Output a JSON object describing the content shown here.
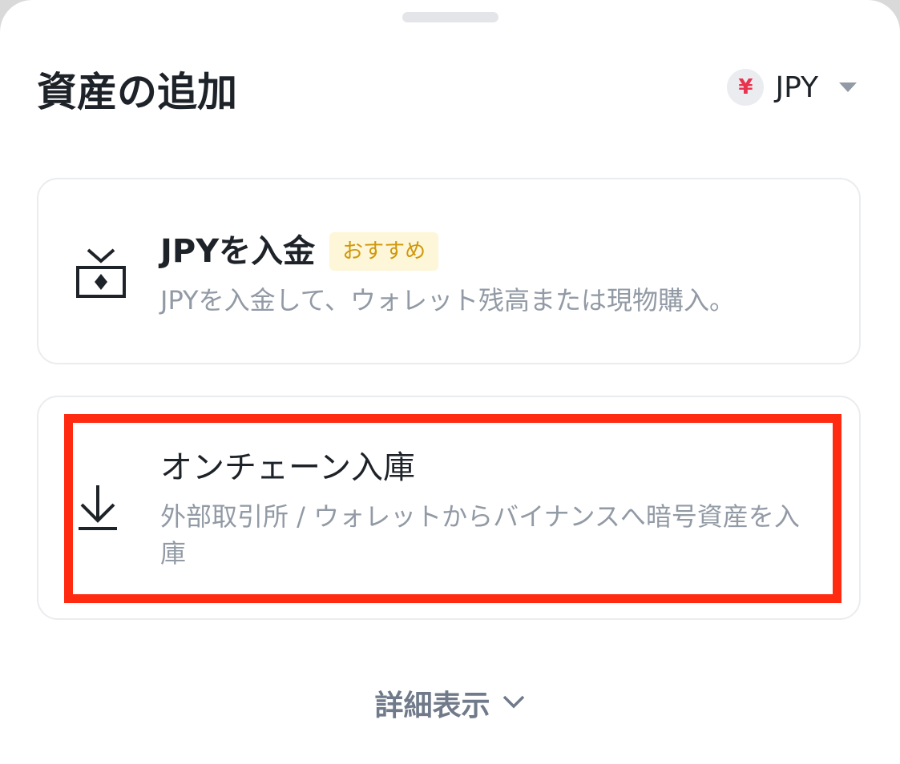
{
  "header": {
    "title": "資産の追加",
    "currency_symbol": "¥",
    "currency_code": "JPY"
  },
  "options": [
    {
      "title": "JPYを入金",
      "badge": "おすすめ",
      "description": "JPYを入金して、ウォレット残高または現物購入。",
      "icon": "bank-deposit-icon"
    },
    {
      "title": "オンチェーン入庫",
      "description": "外部取引所 / ウォレットからバイナンスへ暗号資産を入庫",
      "icon": "download-arrow-icon"
    }
  ],
  "footer": {
    "more_label": "詳細表示"
  },
  "colors": {
    "text_primary": "#1e2329",
    "text_secondary": "#929aa5",
    "badge_text": "#d0980b",
    "badge_bg": "#fdf6d8",
    "yen_icon": "#e8344e",
    "highlight": "#ff2a10"
  }
}
